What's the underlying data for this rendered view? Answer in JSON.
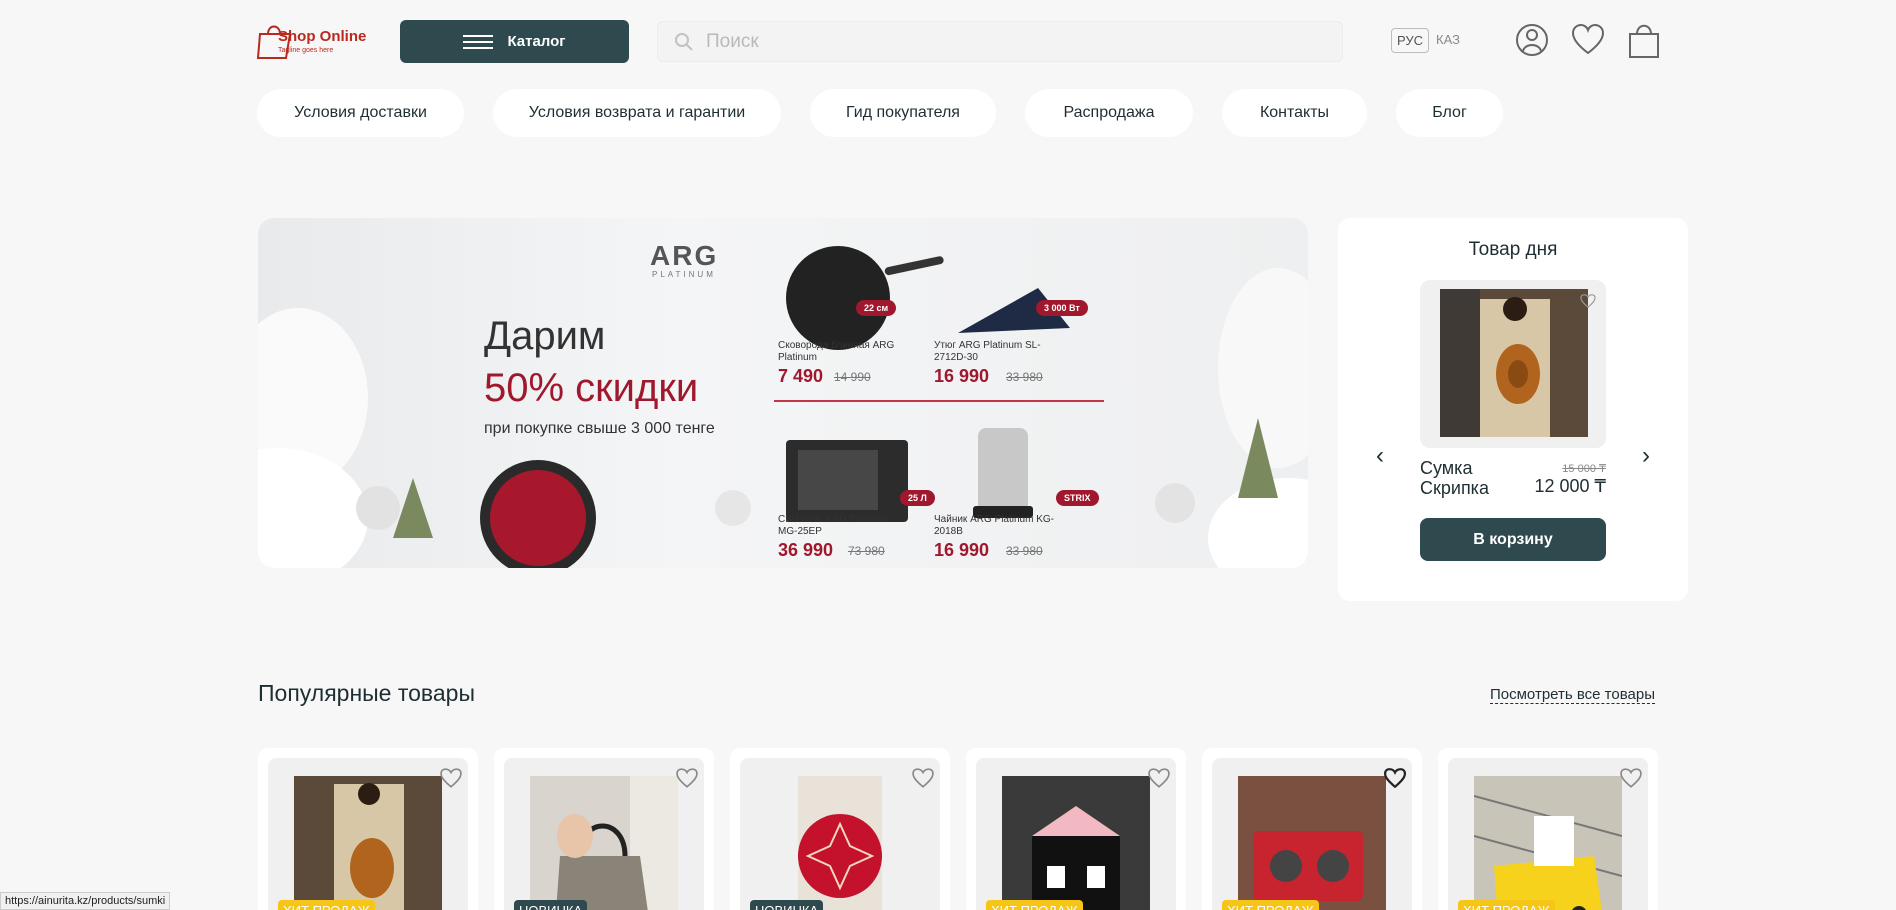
{
  "logo": {
    "name": "Shop Online",
    "tagline": "Tagline goes here"
  },
  "header": {
    "catalog_label": "Каталог",
    "search_placeholder": "Поиск",
    "lang": [
      "РУС",
      "КАЗ"
    ],
    "icons": [
      "user-icon",
      "heart-icon",
      "cart-bag-icon"
    ]
  },
  "nav": [
    "Условия доставки",
    "Условия возврата и гарантии",
    "Гид покупателя",
    "Распродажа",
    "Контакты",
    "Блог"
  ],
  "banner": {
    "brand": "ARG",
    "brand_sub": "PLATINUM",
    "line1": "Дарим",
    "line2": "50% скидки",
    "line3": "при покупке свыше 3 000 тенге",
    "products": [
      {
        "name": "Сковорода блинная ARG Platinum",
        "price": "7 490",
        "old": "14 990",
        "tag": "22 см"
      },
      {
        "name": "Утюг ARG Platinum SL-2712D-30",
        "price": "16 990",
        "old": "33 980",
        "tag": "3 000 Вт"
      },
      {
        "name": "СВЧ-печь ARG Platinum MG-25EP",
        "price": "36 990",
        "old": "73 980",
        "tag": "25 Л"
      },
      {
        "name": "Чайник ARG Platinum KG-2018B",
        "price": "16 990",
        "old": "33 980",
        "tag": "STRIX"
      }
    ]
  },
  "product_of_day": {
    "title": "Товар дня",
    "name": "Сумка Скрипка",
    "old_price": "15 000 ₸",
    "price": "12 000 ₸",
    "button": "В корзину"
  },
  "popular": {
    "title": "Популярные товары",
    "view_all": "Посмотреть все товары",
    "cards": [
      {
        "badge": "ХИТ ПРОДАЖ",
        "type": "hit"
      },
      {
        "badge": "НОВИНКА",
        "type": "new"
      },
      {
        "badge": "НОВИНКА",
        "type": "new"
      },
      {
        "badge": "ХИТ ПРОДАЖ",
        "type": "hit"
      },
      {
        "badge": "ХИТ ПРОДАЖ",
        "type": "hit"
      },
      {
        "badge": "ХИТ ПРОДАЖ",
        "type": "hit"
      }
    ]
  },
  "statusbar": "https://ainurita.kz/products/sumki",
  "colors": {
    "accent": "#2e4a4e",
    "brand_red": "#b8291f",
    "badge_hit": "#f5c518"
  }
}
